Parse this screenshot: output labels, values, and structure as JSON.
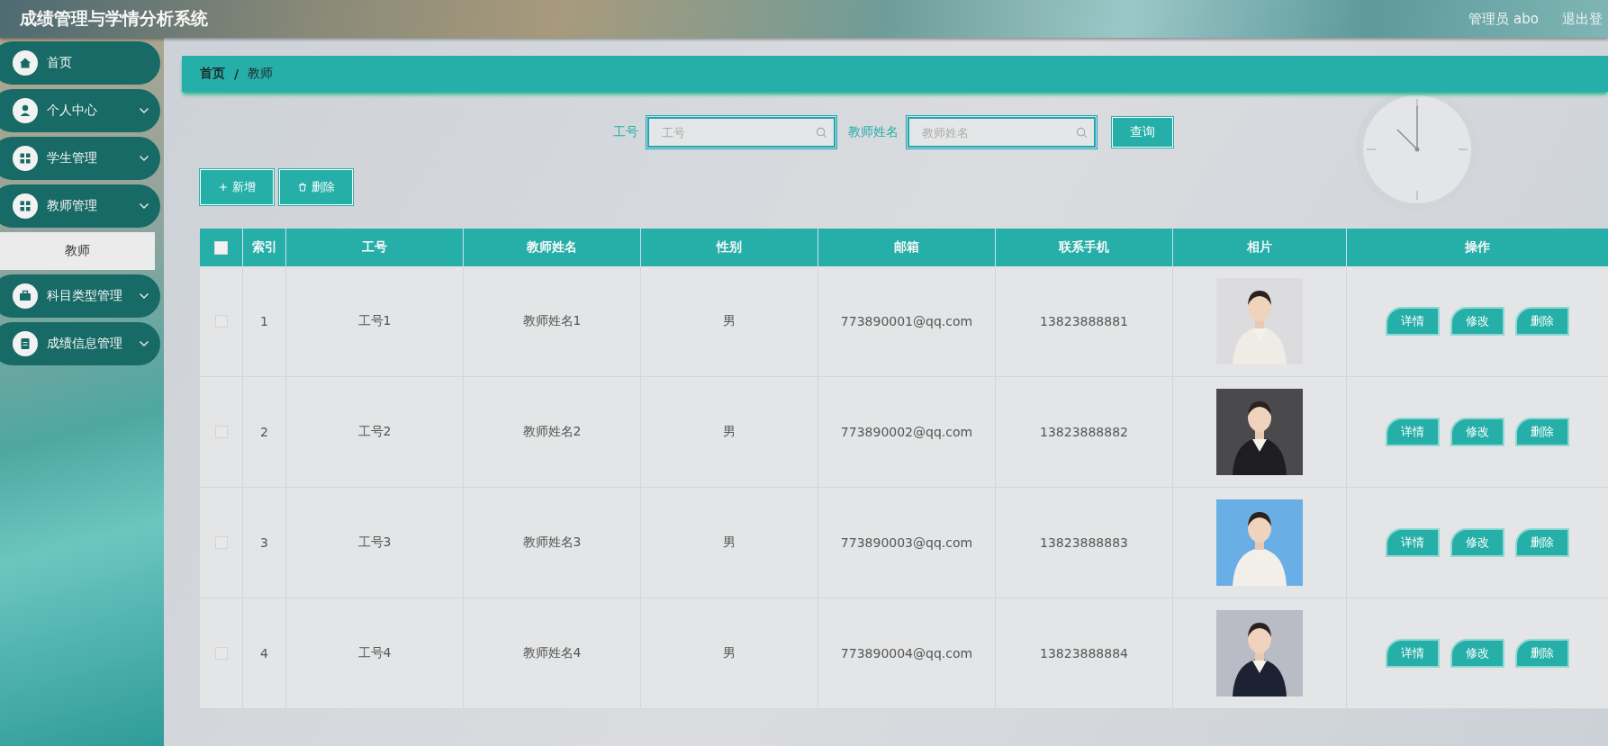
{
  "header": {
    "title": "成绩管理与学情分析系统",
    "user": "管理员 abo",
    "logout": "退出登"
  },
  "sidebar": {
    "items": [
      {
        "label": "首页"
      },
      {
        "label": "个人中心",
        "submenu": true
      },
      {
        "label": "学生管理",
        "submenu": true
      },
      {
        "label": "教师管理",
        "submenu": true,
        "children": [
          {
            "label": "教师",
            "selected": true
          }
        ]
      },
      {
        "label": "科目类型管理",
        "submenu": true
      },
      {
        "label": "成绩信息管理",
        "submenu": true
      }
    ]
  },
  "breadcrumb": [
    "首页",
    "/",
    "教师"
  ],
  "search": {
    "fields": [
      {
        "label": "工号",
        "placeholder": "工号"
      },
      {
        "label": "教师姓名",
        "placeholder": "教师姓名"
      }
    ],
    "button": "查询"
  },
  "actions": [
    {
      "label": "新增",
      "kind": "add"
    },
    {
      "label": "删除",
      "kind": "delete"
    }
  ],
  "table": {
    "select_all": {
      "checked": false
    },
    "columns": [
      "索引",
      "工号",
      "教师姓名",
      "性别",
      "邮箱",
      "联系手机",
      "相片",
      "操作"
    ],
    "rows": [
      {
        "checked": false,
        "cells": [
          "1",
          "工号1",
          "教师姓名1",
          "男",
          "773890001@qq.com",
          "13823888881"
        ],
        "buttons": [
          "详情",
          "修改",
          "删除"
        ]
      },
      {
        "checked": false,
        "cells": [
          "2",
          "工号2",
          "教师姓名2",
          "男",
          "773890002@qq.com",
          "13823888882"
        ],
        "buttons": [
          "详情",
          "修改",
          "删除"
        ]
      },
      {
        "checked": false,
        "cells": [
          "3",
          "工号3",
          "教师姓名3",
          "男",
          "773890003@qq.com",
          "13823888883"
        ],
        "buttons": [
          "详情",
          "修改",
          "删除"
        ]
      },
      {
        "checked": false,
        "cells": [
          "4",
          "工号4",
          "教师姓名4",
          "男",
          "773890004@qq.com",
          "13823888884"
        ],
        "buttons": [
          "详情",
          "修改",
          "删除"
        ]
      }
    ]
  }
}
